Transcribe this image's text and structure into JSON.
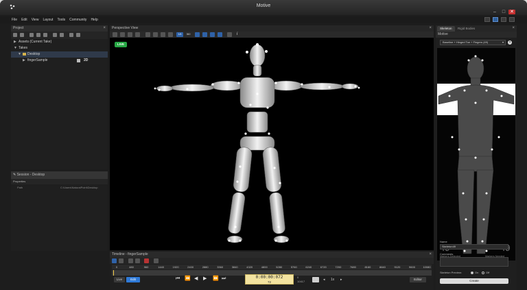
{
  "window": {
    "title": "Motive"
  },
  "window_controls": {
    "minimize": "–",
    "maximize": "□",
    "close": "✕"
  },
  "menu": [
    "File",
    "Edit",
    "View",
    "Layout",
    "Tools",
    "Community",
    "Help"
  ],
  "project": {
    "header": "Project",
    "tree": [
      {
        "label": "Assets (Current Take)",
        "expander": "▶"
      },
      {
        "label": "Takes",
        "expander": "▼"
      },
      {
        "label": "Desktop",
        "expander": "▼"
      },
      {
        "label": "fingerSample",
        "expander": "▶",
        "badge": "2D"
      }
    ]
  },
  "session": {
    "header": "Session - Desktop",
    "properties_label": "Properties",
    "path_label": "Path",
    "path_value": "C:\\Users\\NaturalPoint\\Desktop"
  },
  "viewport": {
    "header": "Perspective View",
    "live": "LIVE",
    "toolbar_labels": [
      "1/4",
      "360"
    ],
    "info_icon": "i"
  },
  "timeline": {
    "header": "Timeline - fingerSample",
    "ticks": [
      "0",
      "480",
      "960",
      "1440",
      "1920",
      "2400",
      "2880",
      "3360",
      "3840",
      "4320",
      "4800",
      "5280",
      "5760",
      "6240",
      "6720",
      "7200",
      "7680",
      "8160",
      "8640",
      "9120",
      "9600",
      "10080"
    ],
    "live_btn": "Live",
    "edit_btn": "Edit",
    "timecode": "0:00:00:072",
    "frame": "72",
    "frame_start": "0",
    "frame_end": "10417",
    "speed": "1x",
    "edit_mode": "Editor",
    "transport": [
      "⏮",
      "⏪",
      "◀",
      "▶",
      "⏩",
      "⏭"
    ]
  },
  "right_panel": {
    "tabs": [
      "Skeleton",
      "Rigid Bodies"
    ],
    "section": "Motive",
    "template": "Baseline + Hinged Toe + Fingers (49)",
    "help": "?",
    "markers_detected": "49",
    "markers_detected_label": "Markers Detected",
    "markers_needed": "49",
    "markers_needed_label": "Markers Needed",
    "name_label": "Name",
    "name_value": "Skeleton49",
    "comments_label": "Comments",
    "preview_label": "Skeleton Preview:",
    "preview_on": "On",
    "preview_off": "Off",
    "create_btn": "Create"
  },
  "colors": {
    "live": "#27a845",
    "accent": "#2f62a8",
    "timecode_bg": "#f3e3a0"
  }
}
